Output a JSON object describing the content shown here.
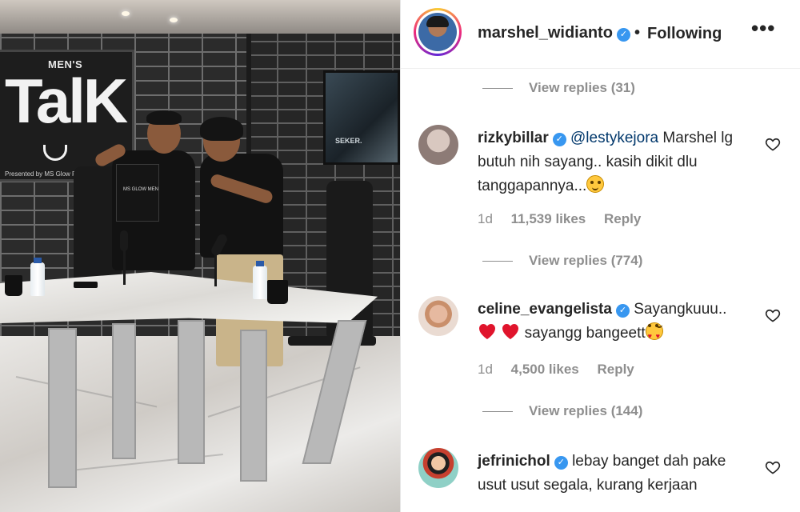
{
  "photo": {
    "sign": {
      "small_text": "MEN'S",
      "big_text": "TalK",
      "presented_by": "Presented by MS Glow For Men"
    },
    "bag_label": "MS GLOW MEN",
    "tv_text": "SEKER."
  },
  "post_header": {
    "username": "marshel_widianto",
    "separator": "•",
    "follow_status": "Following",
    "more_label": "•••",
    "verified": true
  },
  "reply_threads": [
    {
      "label": "View replies (31)"
    },
    {
      "label": "View replies (774)"
    },
    {
      "label": "View replies (144)"
    }
  ],
  "comments": [
    {
      "username": "rizkybillar",
      "mention": "@lestykejora",
      "text": "Marshel lg butuh nih sayang.. kasih dikit dlu tanggapannya...",
      "emoji": "slightly-smiling-face",
      "age": "1d",
      "likes": "11,539 likes",
      "reply_label": "Reply"
    },
    {
      "username": "celine_evangelista",
      "text_before": "Sayangkuuu..",
      "emoji_hearts": "red-heart red-heart",
      "text_after": "sayangg bangeett",
      "emoji": "heart-eyes-face",
      "age": "1d",
      "likes": "4,500 likes",
      "reply_label": "Reply"
    },
    {
      "username": "jefrinichol",
      "text": "lebay banget dah pake usut usut segala, kurang kerjaan"
    }
  ],
  "colors": {
    "verified_blue": "#3897f0",
    "mention_blue": "#00376b",
    "meta_gray": "#8e8e8e",
    "text_dark": "#262626"
  }
}
